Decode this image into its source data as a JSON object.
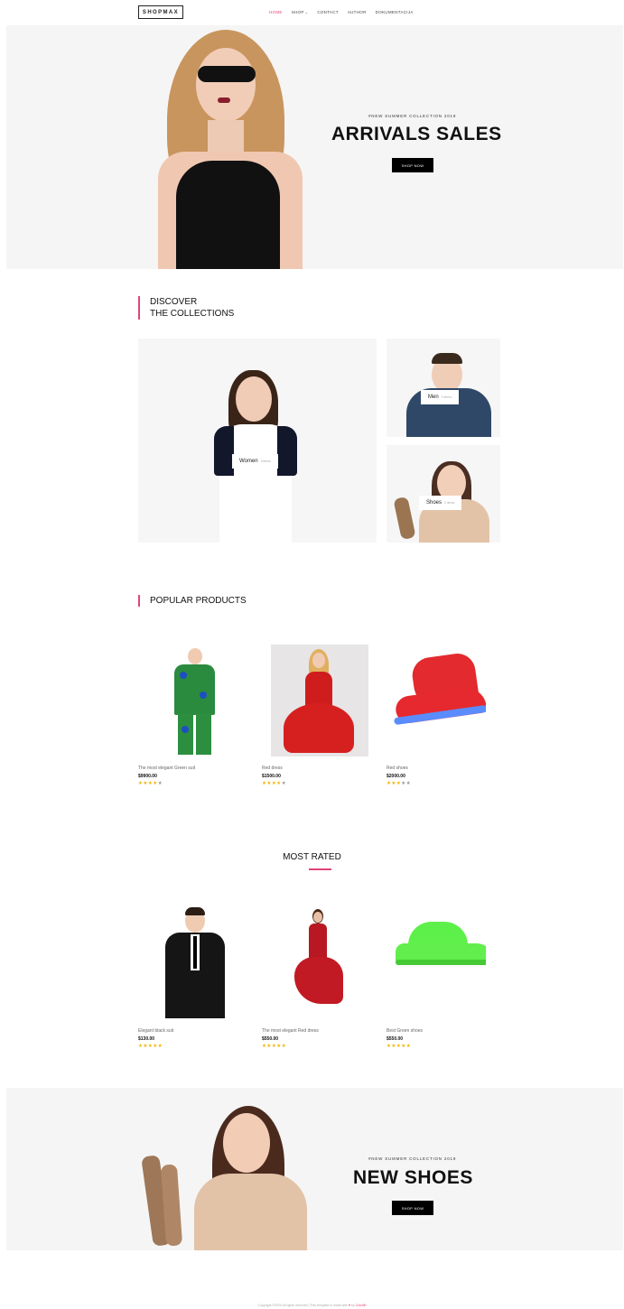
{
  "brand": "SHOPMAX",
  "nav": {
    "items": [
      {
        "label": "HOME",
        "active": true
      },
      {
        "label": "SHOP",
        "caret": true
      },
      {
        "label": "CONTACT"
      },
      {
        "label": "AUTHOR"
      },
      {
        "label": "DOKUMENTACIJA"
      }
    ]
  },
  "hero": {
    "kicker": "#New Summer Collection 2019",
    "title": "ARRIVALS SALES",
    "button": "SHOP NOW"
  },
  "collections": {
    "heading_line1": "DISCOVER",
    "heading_line2": "THE COLLECTIONS",
    "tiles": [
      {
        "label": "Women",
        "sub": "9 items"
      },
      {
        "label": "Men",
        "sub": "9 items"
      },
      {
        "label": "Shoes",
        "sub": "9 items"
      }
    ]
  },
  "popular": {
    "heading": "POPULAR PRODUCTS",
    "items": [
      {
        "name": "The most elegant Green suit",
        "price": "$9900.00",
        "stars": "★★★★",
        "stars_off": "★"
      },
      {
        "name": "Red dress",
        "price": "$1500.00",
        "stars": "★★★★",
        "stars_off": "★"
      },
      {
        "name": "Red shoes",
        "price": "$2000.00",
        "stars": "★★★",
        "stars_off": "★★"
      }
    ]
  },
  "most_rated": {
    "heading": "MOST RATED",
    "items": [
      {
        "name": "Elegant black suit",
        "price": "$130.00",
        "stars": "★★★★★",
        "stars_off": ""
      },
      {
        "name": "The most elegant Red dress",
        "price": "$550.00",
        "stars": "★★★★★",
        "stars_off": ""
      },
      {
        "name": "Best Green shoes",
        "price": "$550.00",
        "stars": "★★★★★",
        "stars_off": ""
      }
    ]
  },
  "banner2": {
    "kicker": "#New Summer Collection 2019",
    "title": "NEW SHOES",
    "button": "SHOP NOW"
  },
  "footer": {
    "text": "Copyright ©2020 All rights reserved | This template is made with",
    "heart": "♥",
    "by": "by",
    "author": "Colorlib"
  },
  "colors": {
    "accent": "#e0457b",
    "button": "#000000",
    "hero_bg": "#f5f5f5"
  }
}
